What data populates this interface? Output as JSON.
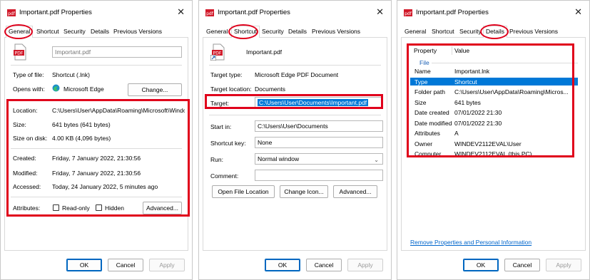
{
  "brand": {
    "red": "#e0001b",
    "selection": "#0078d7",
    "link": "#0066cc"
  },
  "dialogs": [
    {
      "title": "Important.pdf Properties",
      "tabs": [
        "General",
        "Shortcut",
        "Security",
        "Details",
        "Previous Versions"
      ],
      "active_tab": "General",
      "name_value": "Important.pdf",
      "type_label": "Type of file:",
      "type_value": "Shortcut (.lnk)",
      "opens_label": "Opens with:",
      "opens_value": "Microsoft Edge",
      "change_button": "Change...",
      "location_label": "Location:",
      "location_value": "C:\\Users\\User\\AppData\\Roaming\\Microsoft\\Windo",
      "size_label": "Size:",
      "size_value": "641 bytes (641 bytes)",
      "disk_label": "Size on disk:",
      "disk_value": "4.00 KB (4,096 bytes)",
      "created_label": "Created:",
      "created_value": "Friday, 7 January 2022, 21:30:56",
      "modified_label": "Modified:",
      "modified_value": "Friday, 7 January 2022, 21:30:56",
      "accessed_label": "Accessed:",
      "accessed_value": "Today, 24 January 2022, 5 minutes ago",
      "attributes_label": "Attributes:",
      "readonly_label": "Read-only",
      "hidden_label": "Hidden",
      "advanced_button": "Advanced...",
      "ok": "OK",
      "cancel": "Cancel",
      "apply": "Apply"
    },
    {
      "title": "Important.pdf Properties",
      "tabs": [
        "General",
        "Shortcut",
        "Security",
        "Details",
        "Previous Versions"
      ],
      "active_tab": "Shortcut",
      "name_value": "Important.pdf",
      "target_type_label": "Target type:",
      "target_type_value": "Microsoft Edge PDF Document",
      "target_location_label": "Target location:",
      "target_location_value": "Documents",
      "target_label": "Target:",
      "target_value": "C:\\Users\\User\\Documents\\Important.pdf",
      "start_label": "Start in:",
      "start_value": "C:\\Users\\User\\Documents",
      "shortcut_key_label": "Shortcut key:",
      "shortcut_key_value": "None",
      "run_label": "Run:",
      "run_value": "Normal window",
      "comment_label": "Comment:",
      "comment_value": "",
      "open_location_button": "Open File Location",
      "change_icon_button": "Change Icon...",
      "advanced_button": "Advanced...",
      "ok": "OK",
      "cancel": "Cancel",
      "apply": "Apply"
    },
    {
      "title": "Important.pdf Properties",
      "tabs": [
        "General",
        "Shortcut",
        "Security",
        "Details",
        "Previous Versions"
      ],
      "active_tab": "Details",
      "columns": [
        "Property",
        "Value"
      ],
      "group": "File",
      "rows": [
        {
          "property": "Name",
          "value": "Important.lnk"
        },
        {
          "property": "Type",
          "value": "Shortcut"
        },
        {
          "property": "Folder path",
          "value": "C:\\Users\\User\\AppData\\Roaming\\Micros..."
        },
        {
          "property": "Size",
          "value": "641 bytes"
        },
        {
          "property": "Date created",
          "value": "07/01/2022 21:30"
        },
        {
          "property": "Date modified",
          "value": "07/01/2022 21:30"
        },
        {
          "property": "Attributes",
          "value": "A"
        },
        {
          "property": "Owner",
          "value": "WINDEV2112EVAL\\User"
        },
        {
          "property": "Computer",
          "value": "WINDEV2112EVAL (this PC)"
        }
      ],
      "remove_link": "Remove Properties and Personal Information",
      "ok": "OK",
      "cancel": "Cancel",
      "apply": "Apply"
    }
  ]
}
